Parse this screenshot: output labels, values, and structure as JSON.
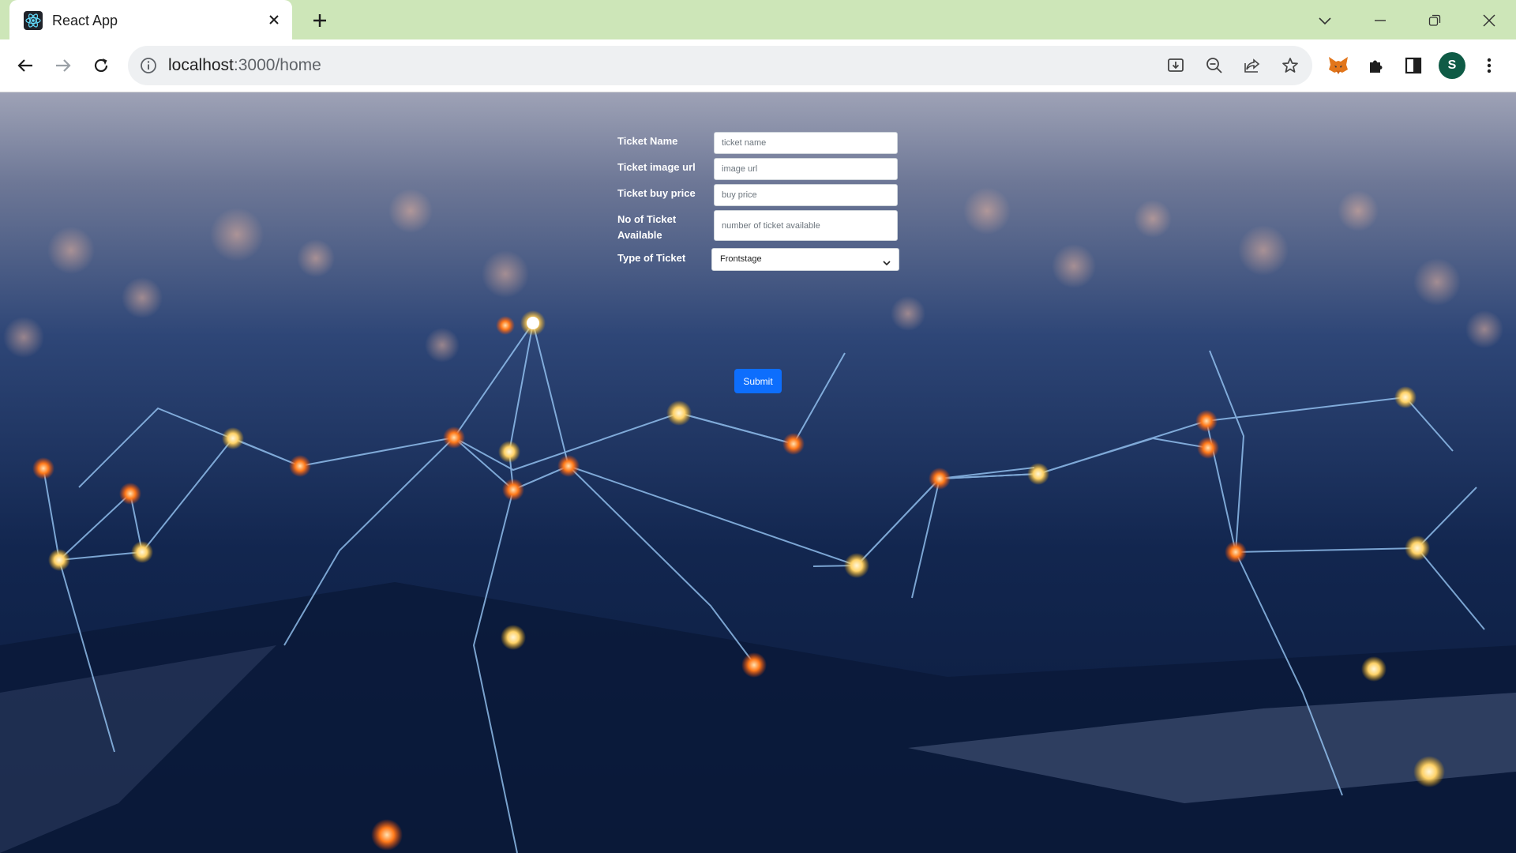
{
  "browser": {
    "tab_title": "React App",
    "url_host": "localhost",
    "url_path": ":3000/home",
    "profile_initial": "S",
    "icons": [
      "react-favicon",
      "close-icon",
      "plus-icon",
      "chevron-down-icon",
      "minimize-icon",
      "restore-icon",
      "close-window-icon",
      "back-arrow-icon",
      "forward-arrow-icon",
      "reload-icon",
      "info-icon",
      "install-icon",
      "zoom-out-icon",
      "share-icon",
      "star-icon",
      "metamask-icon",
      "puzzle-icon",
      "sidepanel-icon",
      "more-vert-icon"
    ]
  },
  "form": {
    "ticket_name_label": "Ticket Name",
    "ticket_name_placeholder": "ticket name",
    "image_url_label": "Ticket image url",
    "image_url_placeholder": "image url",
    "buy_price_label": "Ticket buy price",
    "buy_price_placeholder": "buy price",
    "available_label_line1": "No of Ticket",
    "available_label_line2": "Available",
    "available_placeholder": "number of ticket available",
    "type_label": "Type of Ticket",
    "type_value": "Frontstage",
    "submit_label": "Submit"
  },
  "colors": {
    "tabbar": "#cde6b8",
    "submit": "#0d6efd",
    "page_bg": "#0c1d40",
    "avatar": "#0f5b46"
  }
}
